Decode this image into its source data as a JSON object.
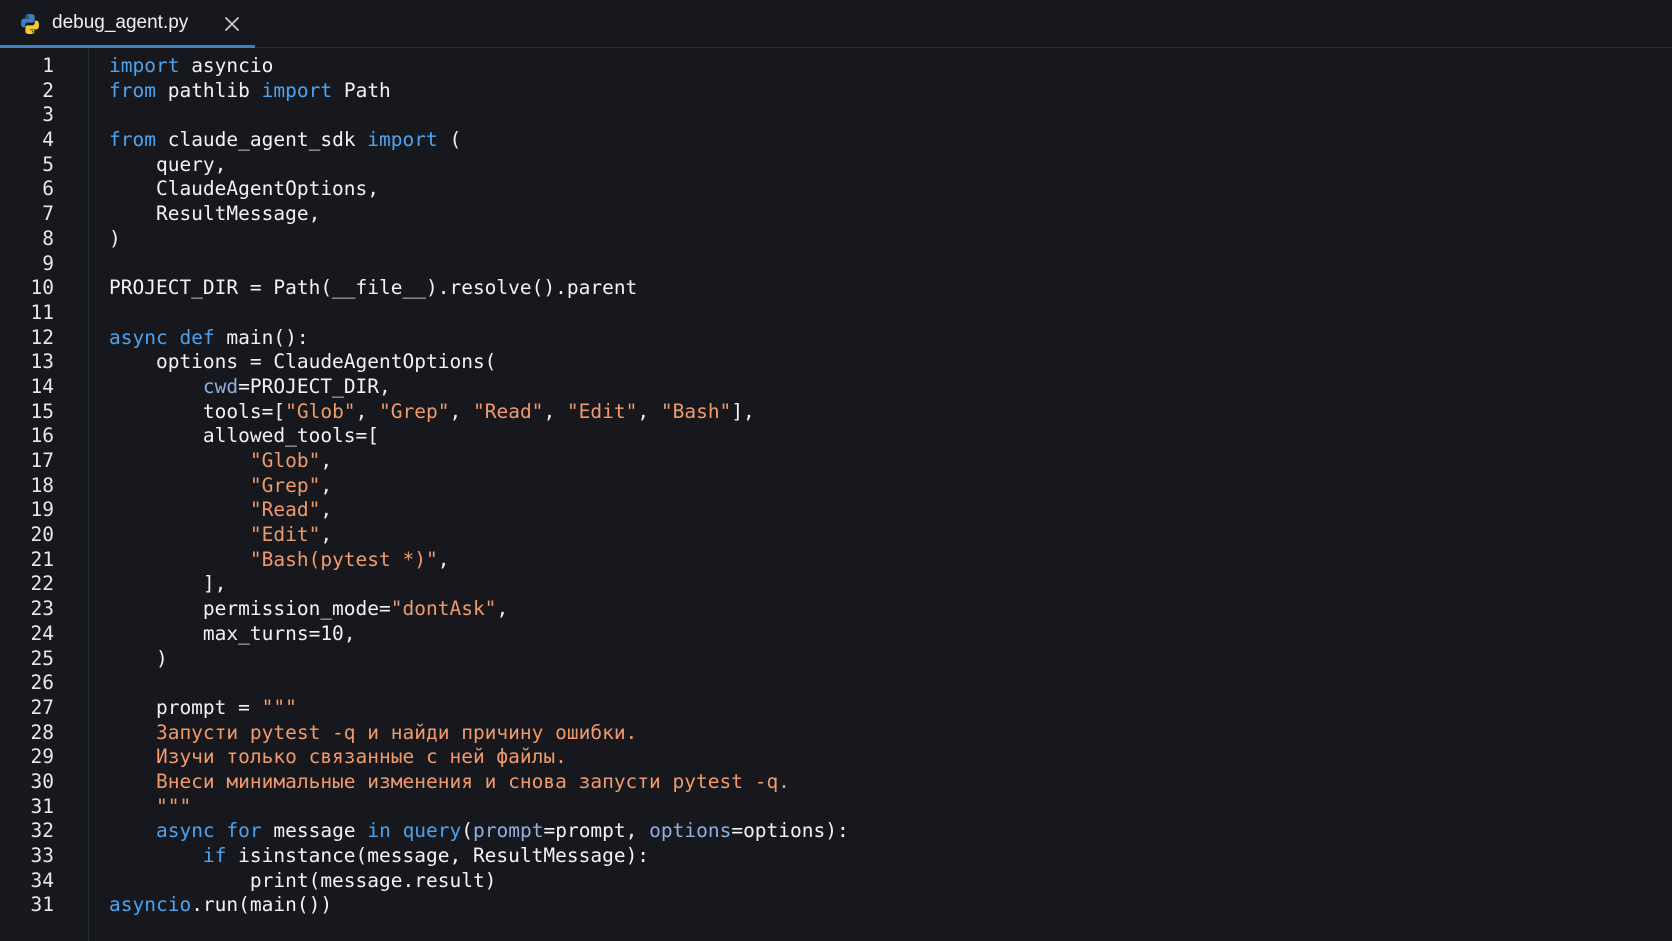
{
  "tab": {
    "title": "debug_agent.py",
    "file_icon": "python-icon",
    "close_icon": "close-icon"
  },
  "colors": {
    "background": "#16181d",
    "keyword": "#4aa3f0",
    "string": "#f09a6a",
    "parameter": "#8fb0de",
    "text": "#f2f2f2",
    "active_tab_underline": "#3b82c4"
  },
  "line_numbers": [
    "1",
    "2",
    "3",
    "4",
    "5",
    "6",
    "7",
    "8",
    "9",
    "10",
    "11",
    "12",
    "13",
    "14",
    "15",
    "16",
    "17",
    "18",
    "19",
    "20",
    "21",
    "22",
    "23",
    "24",
    "25",
    "26",
    "27",
    "28",
    "29",
    "30",
    "31",
    "32",
    "33",
    "34",
    "31"
  ],
  "code_lines": [
    [
      {
        "t": "kw",
        "v": "import"
      },
      {
        "t": "plain",
        "v": " asyncio"
      }
    ],
    [
      {
        "t": "kw",
        "v": "from"
      },
      {
        "t": "plain",
        "v": " pathlib "
      },
      {
        "t": "kw",
        "v": "import"
      },
      {
        "t": "plain",
        "v": " Path"
      }
    ],
    [],
    [
      {
        "t": "kw",
        "v": "from"
      },
      {
        "t": "plain",
        "v": " claude_agent_sdk "
      },
      {
        "t": "kw",
        "v": "import"
      },
      {
        "t": "plain",
        "v": " ("
      }
    ],
    [
      {
        "t": "plain",
        "v": "    query,"
      }
    ],
    [
      {
        "t": "plain",
        "v": "    ClaudeAgentOptions,"
      }
    ],
    [
      {
        "t": "plain",
        "v": "    ResultMessage,"
      }
    ],
    [
      {
        "t": "plain",
        "v": ")"
      }
    ],
    [],
    [
      {
        "t": "plain",
        "v": "PROJECT_DIR = Path(__file__).resolve().parent"
      }
    ],
    [],
    [
      {
        "t": "kw",
        "v": "async"
      },
      {
        "t": "plain",
        "v": " "
      },
      {
        "t": "kw",
        "v": "def"
      },
      {
        "t": "plain",
        "v": " main():"
      }
    ],
    [
      {
        "t": "plain",
        "v": "    options = ClaudeAgentOptions("
      }
    ],
    [
      {
        "t": "plain",
        "v": "        "
      },
      {
        "t": "param",
        "v": "cwd"
      },
      {
        "t": "plain",
        "v": "=PROJECT_DIR,"
      }
    ],
    [
      {
        "t": "plain",
        "v": "        tools=["
      },
      {
        "t": "str",
        "v": "\"Glob\""
      },
      {
        "t": "plain",
        "v": ", "
      },
      {
        "t": "str",
        "v": "\"Grep\""
      },
      {
        "t": "plain",
        "v": ", "
      },
      {
        "t": "str",
        "v": "\"Read\""
      },
      {
        "t": "plain",
        "v": ", "
      },
      {
        "t": "str",
        "v": "\"Edit\""
      },
      {
        "t": "plain",
        "v": ", "
      },
      {
        "t": "str",
        "v": "\"Bash\""
      },
      {
        "t": "plain",
        "v": "],"
      }
    ],
    [
      {
        "t": "plain",
        "v": "        allowed_tools=["
      }
    ],
    [
      {
        "t": "plain",
        "v": "            "
      },
      {
        "t": "str",
        "v": "\"Glob\""
      },
      {
        "t": "plain",
        "v": ","
      }
    ],
    [
      {
        "t": "plain",
        "v": "            "
      },
      {
        "t": "str",
        "v": "\"Grep\""
      },
      {
        "t": "plain",
        "v": ","
      }
    ],
    [
      {
        "t": "plain",
        "v": "            "
      },
      {
        "t": "str",
        "v": "\"Read\""
      },
      {
        "t": "plain",
        "v": ","
      }
    ],
    [
      {
        "t": "plain",
        "v": "            "
      },
      {
        "t": "str",
        "v": "\"Edit\""
      },
      {
        "t": "plain",
        "v": ","
      }
    ],
    [
      {
        "t": "plain",
        "v": "            "
      },
      {
        "t": "str",
        "v": "\"Bash(pytest *)\""
      },
      {
        "t": "plain",
        "v": ","
      }
    ],
    [
      {
        "t": "plain",
        "v": "        ],"
      }
    ],
    [
      {
        "t": "plain",
        "v": "        permission_mode="
      },
      {
        "t": "str",
        "v": "\"dontAsk\""
      },
      {
        "t": "plain",
        "v": ","
      }
    ],
    [
      {
        "t": "plain",
        "v": "        max_turns=10,"
      }
    ],
    [
      {
        "t": "plain",
        "v": "    )"
      }
    ],
    [],
    [
      {
        "t": "plain",
        "v": "    prompt = "
      },
      {
        "t": "str",
        "v": "\"\"\""
      }
    ],
    [
      {
        "t": "str",
        "v": "    Запусти pytest -q и найди причину ошибки."
      }
    ],
    [
      {
        "t": "str",
        "v": "    Изучи только связанные с ней файлы."
      }
    ],
    [
      {
        "t": "str",
        "v": "    Внеси минимальные изменения и снова запусти pytest -q."
      }
    ],
    [
      {
        "t": "str",
        "v": "    \"\"\""
      }
    ],
    [
      {
        "t": "plain",
        "v": "    "
      },
      {
        "t": "kw",
        "v": "async"
      },
      {
        "t": "plain",
        "v": " "
      },
      {
        "t": "kw",
        "v": "for"
      },
      {
        "t": "plain",
        "v": " message "
      },
      {
        "t": "kw",
        "v": "in"
      },
      {
        "t": "plain",
        "v": " "
      },
      {
        "t": "fn",
        "v": "query"
      },
      {
        "t": "plain",
        "v": "("
      },
      {
        "t": "param",
        "v": "prompt"
      },
      {
        "t": "plain",
        "v": "=prompt, "
      },
      {
        "t": "param",
        "v": "options"
      },
      {
        "t": "plain",
        "v": "=options):"
      }
    ],
    [
      {
        "t": "plain",
        "v": "        "
      },
      {
        "t": "kw",
        "v": "if"
      },
      {
        "t": "plain",
        "v": " isinstance(message, ResultMessage):"
      }
    ],
    [
      {
        "t": "plain",
        "v": "            print(message.result)"
      }
    ],
    [
      {
        "t": "fn",
        "v": "asyncio"
      },
      {
        "t": "plain",
        "v": ".run(main())"
      }
    ]
  ]
}
